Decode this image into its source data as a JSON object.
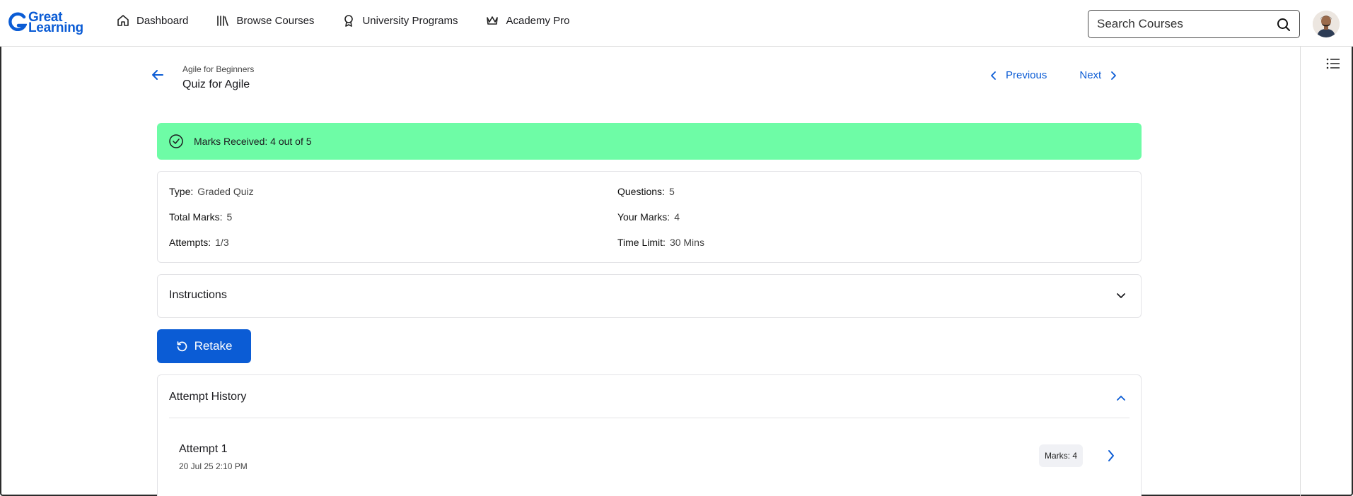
{
  "brand": {
    "line1": "Great",
    "line2": "Learning",
    "color": "#0b5cd5"
  },
  "nav": [
    {
      "label": "Dashboard",
      "icon": "home-icon"
    },
    {
      "label": "Browse Courses",
      "icon": "library-icon"
    },
    {
      "label": "University Programs",
      "icon": "award-ribbon-icon"
    },
    {
      "label": "Academy Pro",
      "icon": "crown-icon"
    }
  ],
  "search": {
    "placeholder": "Search Courses"
  },
  "header": {
    "breadcrumb": "Agile for Beginners",
    "title": "Quiz for Agile",
    "previous_label": "Previous",
    "next_label": "Next"
  },
  "banner": {
    "text": "Marks Received: 4 out of 5",
    "color": "#6efca6"
  },
  "info": {
    "type": {
      "label": "Type:",
      "value": "Graded Quiz"
    },
    "total_marks": {
      "label": "Total Marks:",
      "value": "5"
    },
    "attempts": {
      "label": "Attempts:",
      "value": "1/3"
    },
    "questions": {
      "label": "Questions:",
      "value": "5"
    },
    "your_marks": {
      "label": "Your Marks:",
      "value": "4"
    },
    "time_limit": {
      "label": "Time Limit:",
      "value": "30 Mins"
    }
  },
  "instructions": {
    "label": "Instructions"
  },
  "retake": {
    "label": "Retake"
  },
  "history": {
    "label": "Attempt History",
    "attempts": [
      {
        "name": "Attempt 1",
        "date": "20 Jul 25 2:10 PM",
        "marks": "Marks: 4"
      }
    ]
  },
  "accent": "#0b5cd5"
}
